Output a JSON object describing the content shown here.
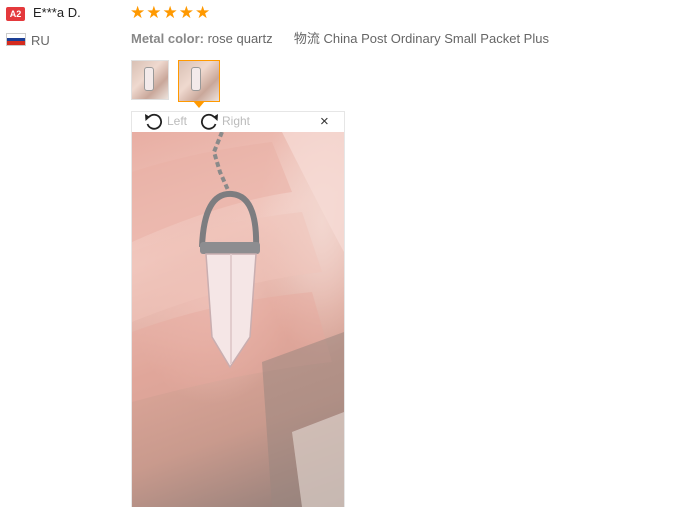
{
  "review": {
    "avatar_badge": "A2",
    "user_name": "E***a D.",
    "country": "RU",
    "rating": 5,
    "stars": [
      "★",
      "★",
      "★",
      "★",
      "★"
    ],
    "metal_label": "Metal color:",
    "metal_value": "rose quartz",
    "shipping_label": "物流",
    "shipping_value": "China Post Ordinary Small Packet Plus"
  },
  "viewer": {
    "rotate_left_label": "Left",
    "rotate_right_label": "Right",
    "close_symbol": "×",
    "selected_thumbnail": 2
  },
  "colors": {
    "star": "#ff9900",
    "badge": "#e4393c",
    "selected_border": "#ff9900"
  }
}
